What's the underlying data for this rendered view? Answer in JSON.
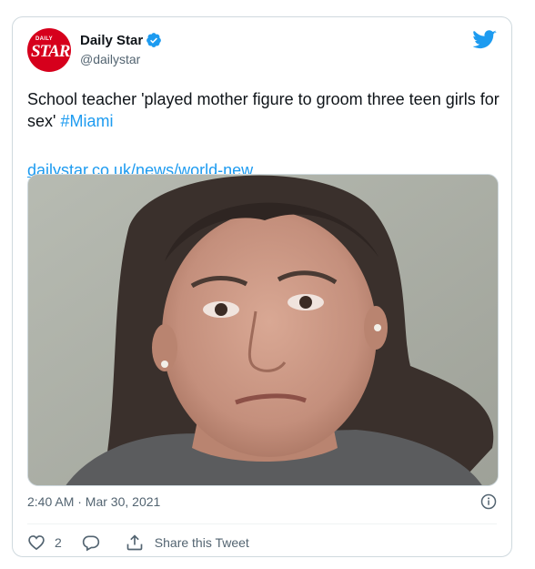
{
  "tweet": {
    "author": {
      "display_name": "Daily Star",
      "handle": "@dailystar",
      "avatar_logo_top": "DAILY",
      "avatar_logo_main": "STAR",
      "verified": true
    },
    "text_body": "School teacher 'played mother figure to groom three teen girls for sex' ",
    "hashtag": "#Miami",
    "link_text": "dailystar.co.uk/news/world-new...",
    "timestamp": "2:40 AM · Mar 30, 2021",
    "like_count": "2",
    "share_label": "Share this Tweet"
  },
  "icons": {
    "brand": "twitter-bird-icon",
    "verified": "verified-badge-icon",
    "info": "info-icon",
    "like": "heart-icon",
    "reply": "reply-bubble-icon",
    "share": "share-icon"
  },
  "colors": {
    "accent": "#1d9bf0",
    "text": "#0f1419",
    "muted": "#536471",
    "border": "#cfd9de",
    "brand_red": "#d6001c"
  }
}
